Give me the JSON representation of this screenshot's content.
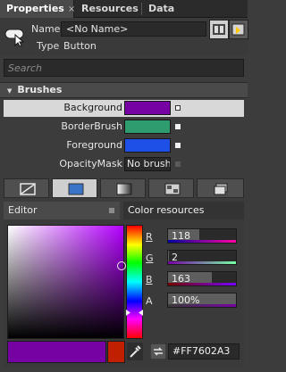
{
  "tabs": [
    {
      "label": "Properties",
      "close": "×"
    },
    {
      "label": "Resources"
    },
    {
      "label": "Data"
    }
  ],
  "header": {
    "name_label": "Name",
    "name_value": "<No Name>",
    "type_label": "Type",
    "type_value": "Button",
    "icons": [
      "button-object-icon",
      "properties-view-icon",
      "events-view-icon"
    ]
  },
  "search": {
    "placeholder": "Search"
  },
  "brushes": {
    "title": "Brushes",
    "rows": [
      {
        "label": "Background",
        "color": "#7602A3"
      },
      {
        "label": "BorderBrush",
        "color": "#2E9C6E"
      },
      {
        "label": "Foreground",
        "color": "#1E4FE6"
      },
      {
        "label": "OpacityMask",
        "value": "No brush"
      }
    ]
  },
  "brush_modes": [
    "no-brush-icon",
    "solid-color-brush-icon",
    "gradient-brush-icon",
    "tile-brush-icon",
    "brush-resources-icon"
  ],
  "editor": {
    "tab_editor": "Editor",
    "tab_resources": "Color resources",
    "current_color": "#7602A3",
    "original_color": "#C02000",
    "channels": [
      {
        "label": "R",
        "value": "118",
        "fraction": 0.4627
      },
      {
        "label": "G",
        "value": "2",
        "fraction": 0.0078
      },
      {
        "label": "B",
        "value": "163",
        "fraction": 0.6392
      },
      {
        "label": "A",
        "value": "100%",
        "fraction": 1.0
      }
    ],
    "hex": "#FF7602A3"
  },
  "colors": {
    "panel": "#3c3c3c",
    "selected_row": "#d8d8d8",
    "field": "#2a2a2a"
  }
}
